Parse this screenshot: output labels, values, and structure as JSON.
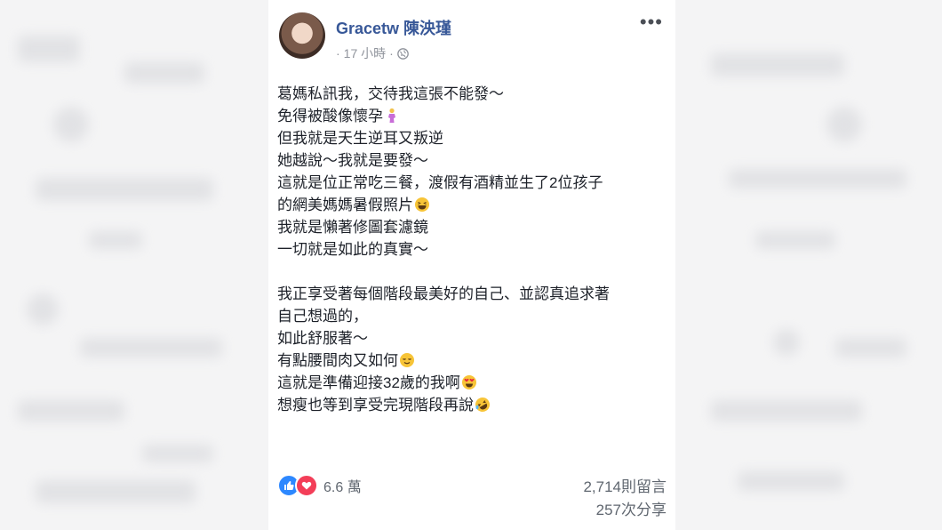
{
  "post": {
    "author": "Gracetw 陳泱瑾",
    "time_prefix": "·",
    "time": "17 小時",
    "time_suffix": "·",
    "privacy_icon": "globe-icon",
    "more_icon": "more-options-icon",
    "lines": [
      {
        "text": "葛媽私訊我，交待我這張不能發～",
        "emoji": ""
      },
      {
        "text": "免得被酸像懷孕",
        "emoji": "pregnant-woman-emoji"
      },
      {
        "text": "但我就是天生逆耳又叛逆",
        "emoji": ""
      },
      {
        "text": "她越說～我就是要發～",
        "emoji": ""
      },
      {
        "text": "這就是位正常吃三餐，渡假有酒精並生了2位孩子",
        "emoji": ""
      },
      {
        "text": "的網美媽媽暑假照片",
        "emoji": "laughing-face-emoji"
      },
      {
        "text": "我就是懶著修圖套濾鏡",
        "emoji": ""
      },
      {
        "text": "一切就是如此的真實～",
        "emoji": ""
      }
    ],
    "lines2": [
      {
        "text": "我正享受著每個階段最美好的自己、並認真追求著",
        "emoji": ""
      },
      {
        "text": "自己想過的，",
        "emoji": ""
      },
      {
        "text": "如此舒服著～",
        "emoji": ""
      },
      {
        "text": "有點腰間肉又如何",
        "emoji": "relieved-face-emoji"
      },
      {
        "text": "這就是準備迎接32歲的我啊",
        "emoji": "heart-eyes-emoji"
      },
      {
        "text": "想瘦也等到享受完現階段再說",
        "emoji": "rofl-emoji"
      }
    ],
    "reactions": {
      "icons": [
        "like-icon",
        "love-icon"
      ],
      "count": "6.6 萬"
    },
    "comments": "2,714則留言",
    "shares": "257次分享"
  }
}
